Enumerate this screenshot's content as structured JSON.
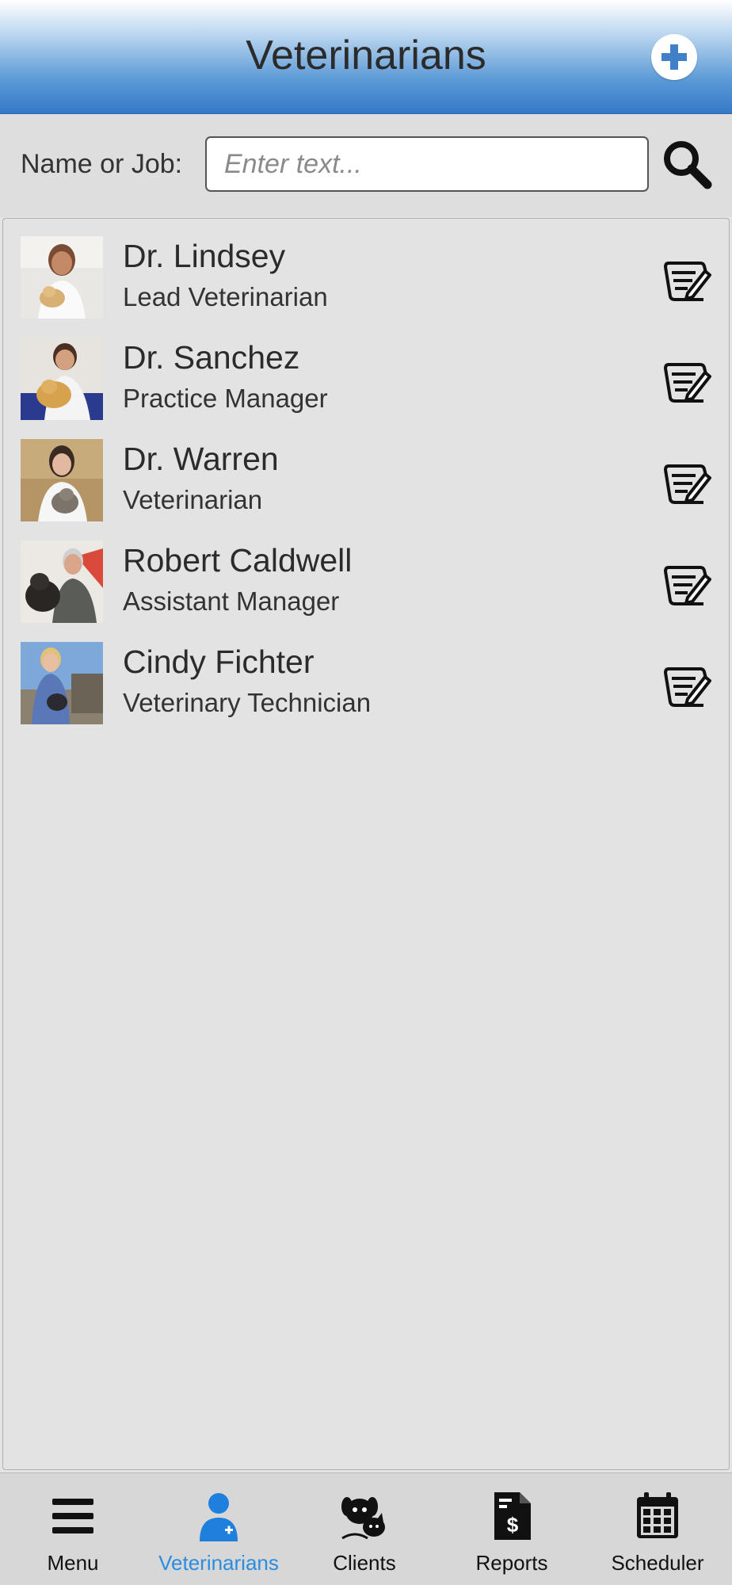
{
  "header": {
    "title": "Veterinarians",
    "add_icon": "plus-circle-icon"
  },
  "search": {
    "label": "Name or Job:",
    "placeholder": "Enter text...",
    "value": "",
    "icon": "search-icon"
  },
  "staff": [
    {
      "name": "Dr. Lindsey",
      "job": "Lead Veterinarian",
      "photo": "woman holding kitten"
    },
    {
      "name": "Dr. Sanchez",
      "job": "Practice Manager",
      "photo": "man with golden retriever"
    },
    {
      "name": "Dr. Warren",
      "job": "Veterinarian",
      "photo": "woman holding cat"
    },
    {
      "name": "Robert Caldwell",
      "job": "Assistant Manager",
      "photo": "man with black dog"
    },
    {
      "name": "Cindy Fichter",
      "job": "Veterinary Technician",
      "photo": "woman holding small dog outdoors"
    }
  ],
  "tabs": [
    {
      "label": "Menu",
      "icon": "hamburger-menu-icon",
      "active": false
    },
    {
      "label": "Veterinarians",
      "icon": "doctor-icon",
      "active": true
    },
    {
      "label": "Clients",
      "icon": "dog-cat-icon",
      "active": false
    },
    {
      "label": "Reports",
      "icon": "dollar-document-icon",
      "active": false
    },
    {
      "label": "Scheduler",
      "icon": "calendar-icon",
      "active": false
    }
  ],
  "colors": {
    "header_top": "#ffffff",
    "header_bottom": "#3479c8",
    "active_tab": "#2a8de0",
    "add_icon": "#3f80c8"
  }
}
